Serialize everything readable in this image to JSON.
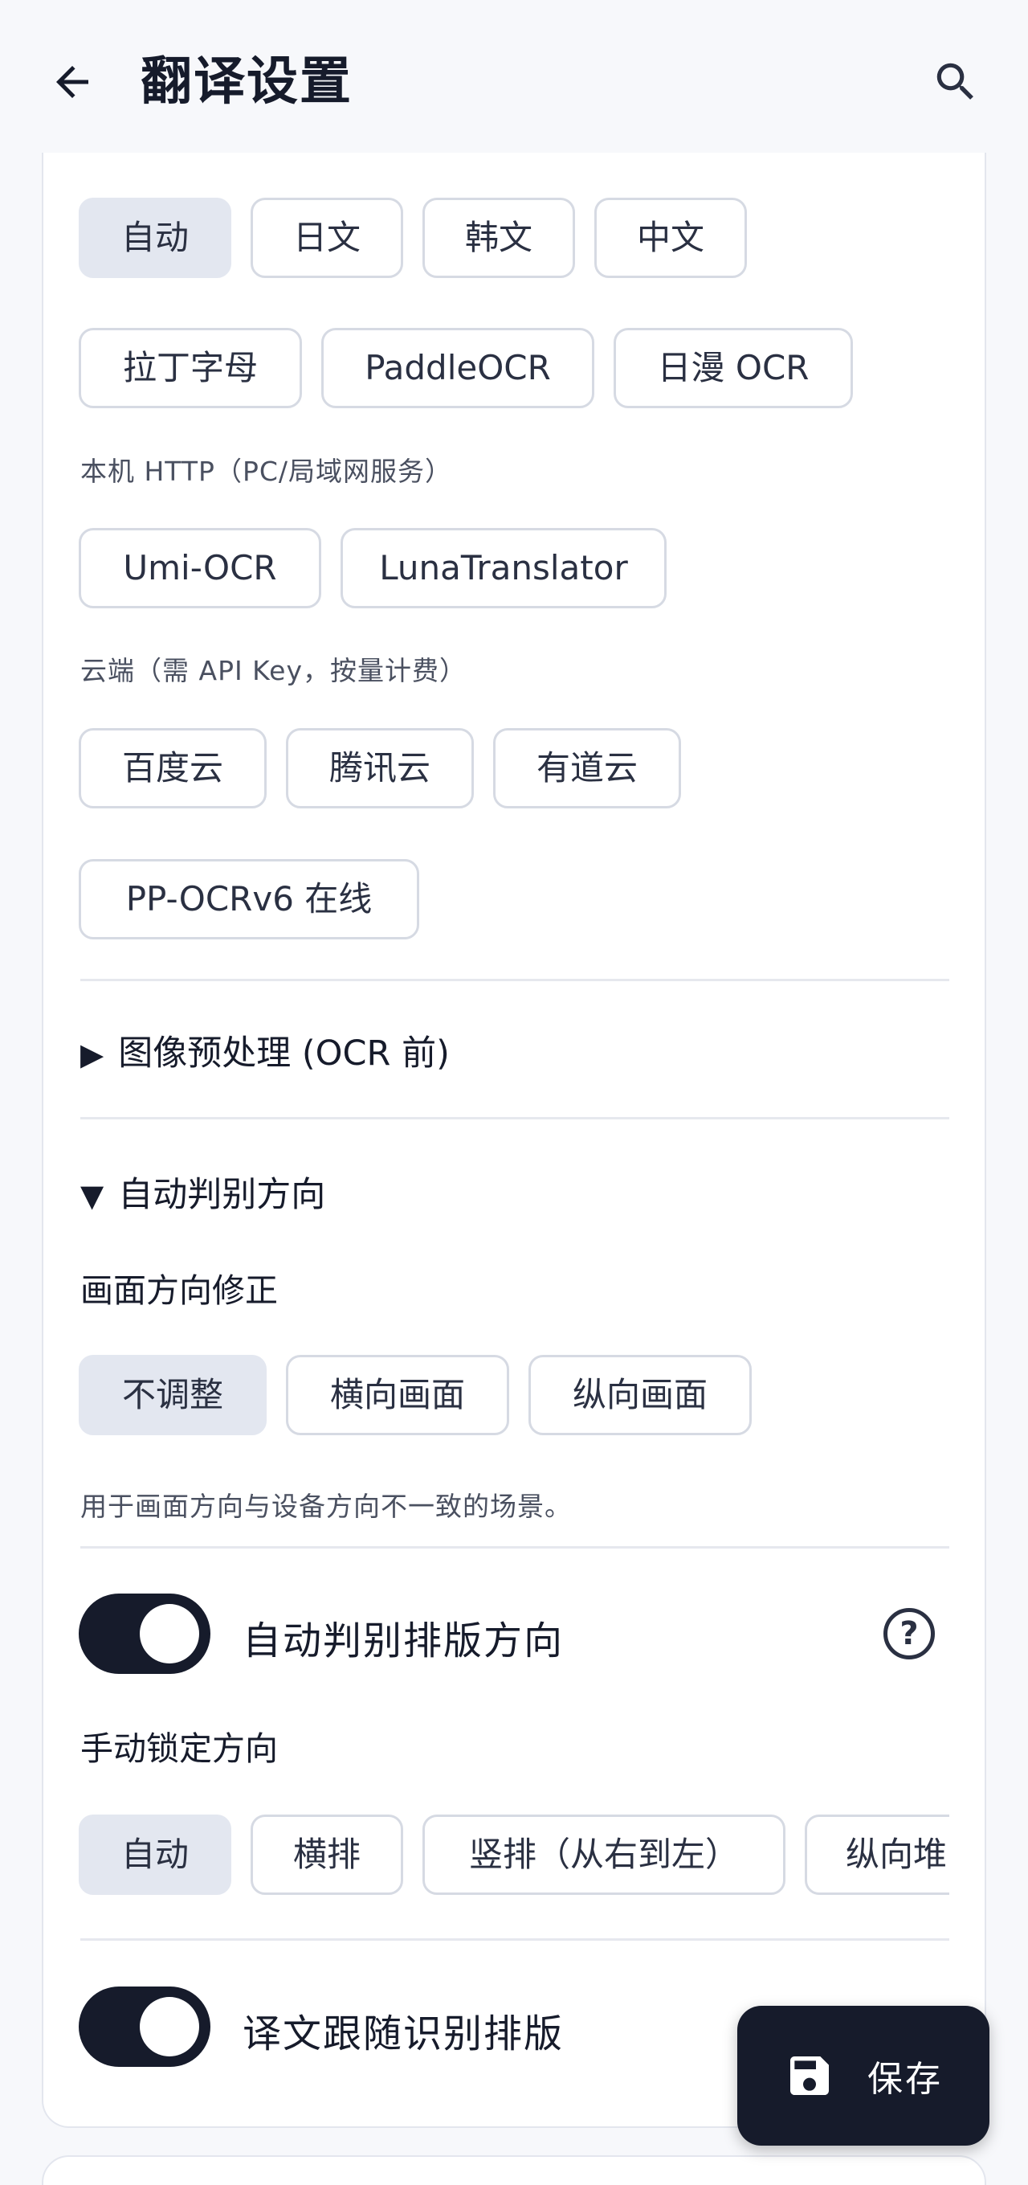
{
  "app_bar": {
    "title": "翻译设置",
    "back_icon": "arrow-left-icon",
    "search_icon": "search-icon"
  },
  "ocr_lang_chips": [
    {
      "label": "自动",
      "selected": true
    },
    {
      "label": "日文",
      "selected": false
    },
    {
      "label": "韩文",
      "selected": false
    },
    {
      "label": "中文",
      "selected": false
    }
  ],
  "ocr_engine_chips": [
    {
      "label": "拉丁字母",
      "selected": false
    },
    {
      "label": "PaddleOCR",
      "selected": false
    },
    {
      "label": "日漫 OCR",
      "selected": false
    }
  ],
  "local_http": {
    "caption": "本机 HTTP（PC/局域网服务）",
    "chips": [
      {
        "label": "Umi-OCR",
        "selected": false
      },
      {
        "label": "LunaTranslator",
        "selected": false
      }
    ]
  },
  "cloud": {
    "caption": "云端（需 API Key，按量计费）",
    "chips": [
      {
        "label": "百度云",
        "selected": false
      },
      {
        "label": "腾讯云",
        "selected": false
      },
      {
        "label": "有道云",
        "selected": false
      },
      {
        "label": "PP-OCRv6 在线",
        "selected": false
      }
    ]
  },
  "preprocess_section": {
    "arrow": "▶",
    "title": "图像预处理 (OCR 前)"
  },
  "direction_section": {
    "arrow": "▼",
    "title": "自动判别方向",
    "screen_label": "画面方向修正",
    "screen_chips": [
      {
        "label": "不调整",
        "selected": true
      },
      {
        "label": "横向画面",
        "selected": false
      },
      {
        "label": "纵向画面",
        "selected": false
      }
    ],
    "screen_hint": "用于画面方向与设备方向不一致的场景。"
  },
  "auto_layout_toggle": {
    "label": "自动判别排版方向",
    "on": true,
    "help_icon": "help-circle-icon",
    "help_glyph": "?"
  },
  "manual_lock": {
    "label": "手动锁定方向",
    "chips": [
      {
        "label": "自动",
        "selected": true
      },
      {
        "label": "横排",
        "selected": false
      },
      {
        "label": "竖排（从右到左）",
        "selected": false
      },
      {
        "label": "纵向堆",
        "selected": false
      }
    ]
  },
  "follow_layout_toggle": {
    "label": "译文跟随识别排版",
    "on": true
  },
  "fab": {
    "label": "保存",
    "icon": "save-icon"
  },
  "colors": {
    "primary": "#161b2b",
    "chip_selected": "#e3e7f0",
    "chip_border": "#d6dae3",
    "background": "#f7f8fb"
  }
}
